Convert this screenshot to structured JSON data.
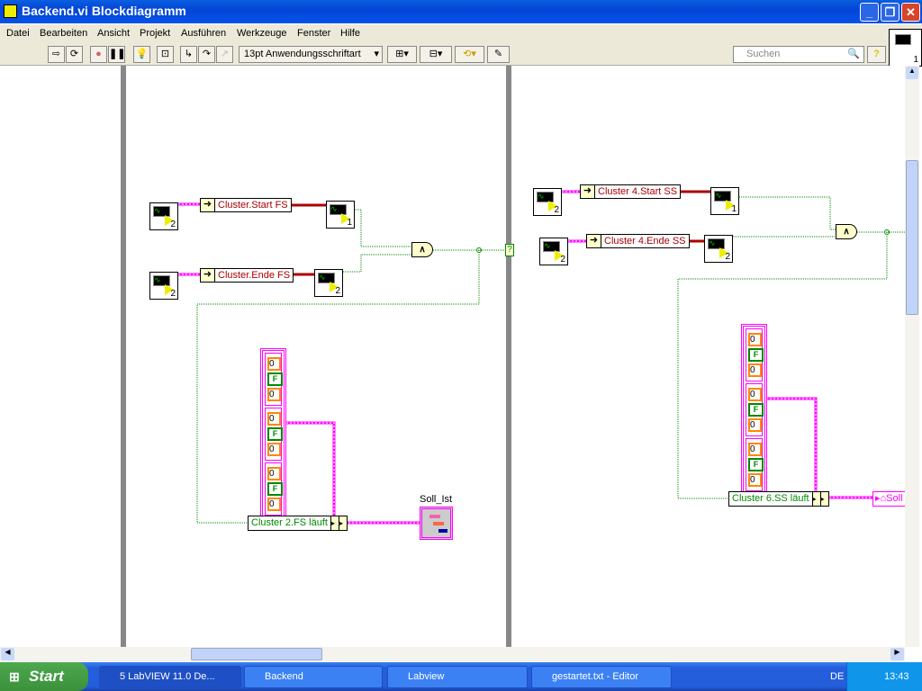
{
  "window": {
    "title": "Backend.vi Blockdiagramm",
    "minimize": "_",
    "restore": "❐",
    "close": "✕"
  },
  "menu": [
    "Datei",
    "Bearbeiten",
    "Ansicht",
    "Projekt",
    "Ausführen",
    "Werkzeuge",
    "Fenster",
    "Hilfe"
  ],
  "toolbar": {
    "font": "13pt Anwendungsschriftart",
    "search_placeholder": "Suchen",
    "help": "?",
    "connector_number": "1"
  },
  "diagram": {
    "left": {
      "bundle_start": "Cluster.Start FS",
      "bundle_end": "Cluster.Ende FS",
      "vi_numbers": [
        "2",
        "1",
        "2",
        "2"
      ],
      "and": "∧",
      "selector": "?",
      "array": [
        [
          "0",
          "F",
          "0"
        ],
        [
          "0",
          "F",
          "0"
        ],
        [
          "0",
          "F",
          "0"
        ]
      ],
      "unbundle": "Cluster 2.FS läuft",
      "indicator_label": "Soll_Ist"
    },
    "right": {
      "bundle_start": "Cluster 4.Start SS",
      "bundle_end": "Cluster 4.Ende SS",
      "vi_numbers": [
        "2",
        "1",
        "2",
        "2"
      ],
      "and": "∧",
      "array": [
        [
          "0",
          "F",
          "0"
        ],
        [
          "0",
          "F",
          "0"
        ],
        [
          "0",
          "F",
          "0"
        ]
      ],
      "unbundle": "Cluster 6.SS läuft",
      "local_var": "Soll"
    }
  },
  "taskbar": {
    "start": "Start",
    "tasks": [
      "5 LabVIEW 11.0 De...",
      "Backend",
      "Labview",
      "gestartet.txt - Editor"
    ],
    "lang": "DE",
    "clock": "13:43"
  },
  "colors": {
    "string_wire": "#ff00ff",
    "bool_wire": "#008000",
    "cluster_wire": "#a00000",
    "titlebar": "#0553e8"
  }
}
